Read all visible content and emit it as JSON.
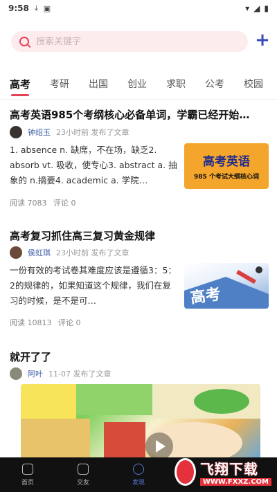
{
  "status_bar": {
    "time": "9:58",
    "download_icon": "download-icon",
    "app_icon": "app-notification-icon"
  },
  "search": {
    "placeholder": "搜索关键字"
  },
  "add_button": {
    "icon": "plus-icon"
  },
  "tabs": [
    {
      "label": "高考",
      "active": true
    },
    {
      "label": "考研"
    },
    {
      "label": "出国"
    },
    {
      "label": "创业"
    },
    {
      "label": "求职"
    },
    {
      "label": "公考"
    },
    {
      "label": "校园"
    }
  ],
  "articles": [
    {
      "title": "高考英语985个考纲核心必备单词，学霸已经开始…",
      "author": "钟绍玉",
      "posted": "23小时前 发布了文章",
      "excerpt": "1. absence n. 缺席，不在场，缺乏2. absorb vt. 吸收，使专心3. abstract a. 抽象的 n.摘要4. academic a. 学院…",
      "thumb_title": "高考英语",
      "thumb_subtitle": "985 个考试大纲核心词",
      "reads": "阅读 7083",
      "comments": "评论 0"
    },
    {
      "title": "高考复习抓住高三复习黄金规律",
      "author": "侯虹琪",
      "posted": "23小时前 发布了文章",
      "excerpt": "一份有效的考试卷其难度应该是遵循3：5：2的规律的，如果知道这个规律，我们在复习的时候，是不是可…",
      "reads": "阅读 10813",
      "comments": "评论 0"
    },
    {
      "title": "就开了了",
      "author": "阿叶",
      "posted": "11-07 发布了文章"
    }
  ],
  "bottom_nav": [
    {
      "label": "首页"
    },
    {
      "label": "交友"
    },
    {
      "label": "发现",
      "active": true
    }
  ],
  "watermark": {
    "title": "飞翔下载",
    "subtitle": "WWW.FXXZ.COM"
  },
  "colors": {
    "accent": "#e5425a",
    "author": "#3b5ba8",
    "nav_bg": "#111111",
    "nav_active": "#5a78d8"
  }
}
